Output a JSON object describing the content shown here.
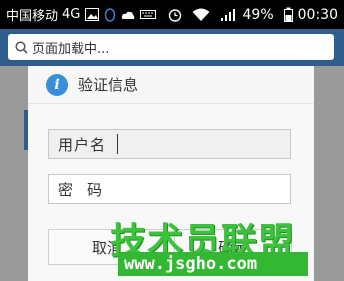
{
  "status_bar": {
    "carrier": "中国移动",
    "network": "4G",
    "battery": "49%",
    "time": "00:30"
  },
  "browser": {
    "address_text": "页面加载中..."
  },
  "dialog": {
    "title": "验证信息",
    "username_label": "用户名",
    "password_label": "密码",
    "cancel_label": "取消",
    "confirm_label": "确定"
  },
  "watermark": {
    "main": "技术员联盟",
    "url": "www.jsgho.com"
  },
  "colors": {
    "address_bar": "#2f5e8e",
    "info_icon": "#3a8ed8",
    "watermark_green": "#3cc33c"
  }
}
